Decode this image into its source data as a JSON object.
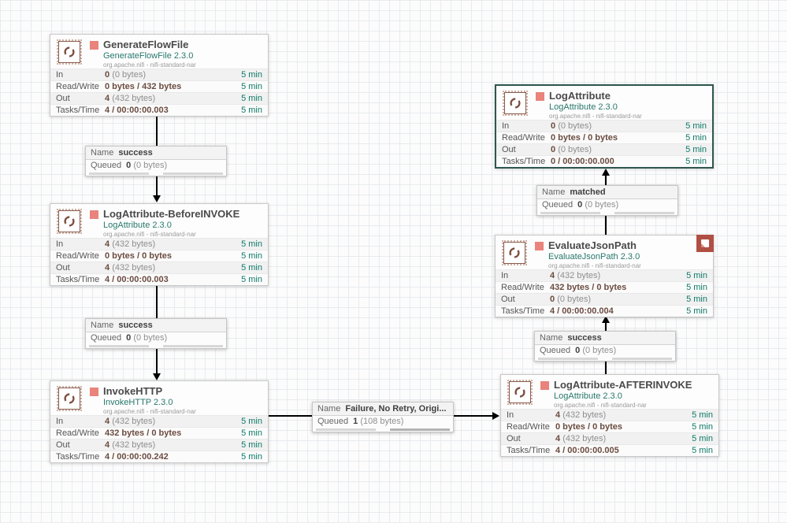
{
  "colors": {
    "run_stopped_square": "#e9837b",
    "type_teal": "#27786c",
    "period_teal": "#0f7a69",
    "bulletin_red": "#b04f44",
    "selection_border": "#2e564e",
    "connection_line": "#000000"
  },
  "processors": [
    {
      "name": "GenerateFlowFile",
      "type": "GenerateFlowFile 2.3.0",
      "bundle": "org.apache.nifi - nifi-standard-nar",
      "stats": [
        {
          "label": "In",
          "value": "0",
          "extra": "(0 bytes)",
          "period": "5 min"
        },
        {
          "label": "Read/Write",
          "value": "0 bytes / 432 bytes",
          "extra": "",
          "period": "5 min"
        },
        {
          "label": "Out",
          "value": "4",
          "extra": "(432 bytes)",
          "period": "5 min"
        },
        {
          "label": "Tasks/Time",
          "value": "4 / 00:00:00.003",
          "extra": "",
          "period": "5 min"
        }
      ]
    },
    {
      "name": "LogAttribute-BeforeINVOKE",
      "type": "LogAttribute 2.3.0",
      "bundle": "org.apache.nifi - nifi-standard-nar",
      "stats": [
        {
          "label": "In",
          "value": "4",
          "extra": "(432 bytes)",
          "period": "5 min"
        },
        {
          "label": "Read/Write",
          "value": "0 bytes / 0 bytes",
          "extra": "",
          "period": "5 min"
        },
        {
          "label": "Out",
          "value": "4",
          "extra": "(432 bytes)",
          "period": "5 min"
        },
        {
          "label": "Tasks/Time",
          "value": "4 / 00:00:00.003",
          "extra": "",
          "period": "5 min"
        }
      ]
    },
    {
      "name": "InvokeHTTP",
      "type": "InvokeHTTP 2.3.0",
      "bundle": "org.apache.nifi - nifi-standard-nar",
      "stats": [
        {
          "label": "In",
          "value": "4",
          "extra": "(432 bytes)",
          "period": "5 min"
        },
        {
          "label": "Read/Write",
          "value": "432 bytes / 0 bytes",
          "extra": "",
          "period": "5 min"
        },
        {
          "label": "Out",
          "value": "4",
          "extra": "(432 bytes)",
          "period": "5 min"
        },
        {
          "label": "Tasks/Time",
          "value": "4 / 00:00:00.242",
          "extra": "",
          "period": "5 min"
        }
      ]
    },
    {
      "name": "LogAttribute",
      "type": "LogAttribute 2.3.0",
      "bundle": "org.apache.nifi - nifi-standard-nar",
      "stats": [
        {
          "label": "In",
          "value": "0",
          "extra": "(0 bytes)",
          "period": "5 min"
        },
        {
          "label": "Read/Write",
          "value": "0 bytes / 0 bytes",
          "extra": "",
          "period": "5 min"
        },
        {
          "label": "Out",
          "value": "0",
          "extra": "(0 bytes)",
          "period": "5 min"
        },
        {
          "label": "Tasks/Time",
          "value": "0 / 00:00:00.000",
          "extra": "",
          "period": "5 min"
        }
      ]
    },
    {
      "name": "EvaluateJsonPath",
      "type": "EvaluateJsonPath 2.3.0",
      "bundle": "org.apache.nifi - nifi-standard-nar",
      "stats": [
        {
          "label": "In",
          "value": "4",
          "extra": "(432 bytes)",
          "period": "5 min"
        },
        {
          "label": "Read/Write",
          "value": "432 bytes / 0 bytes",
          "extra": "",
          "period": "5 min"
        },
        {
          "label": "Out",
          "value": "0",
          "extra": "(0 bytes)",
          "period": "5 min"
        },
        {
          "label": "Tasks/Time",
          "value": "4 / 00:00:00.004",
          "extra": "",
          "period": "5 min"
        }
      ]
    },
    {
      "name": "LogAttribute-AFTERINVOKE",
      "type": "LogAttribute 2.3.0",
      "bundle": "org.apache.nifi - nifi-standard-nar",
      "stats": [
        {
          "label": "In",
          "value": "4",
          "extra": "(432 bytes)",
          "period": "5 min"
        },
        {
          "label": "Read/Write",
          "value": "0 bytes / 0 bytes",
          "extra": "",
          "period": "5 min"
        },
        {
          "label": "Out",
          "value": "4",
          "extra": "(432 bytes)",
          "period": "5 min"
        },
        {
          "label": "Tasks/Time",
          "value": "4 / 00:00:00.005",
          "extra": "",
          "period": "5 min"
        }
      ]
    }
  ],
  "connections": [
    {
      "key_name": "Name",
      "name": "success",
      "key_queued": "Queued",
      "queued": "0",
      "extra": "(0 bytes)"
    },
    {
      "key_name": "Name",
      "name": "success",
      "key_queued": "Queued",
      "queued": "0",
      "extra": "(0 bytes)"
    },
    {
      "key_name": "Name",
      "name": "Failure, No Retry, Origi...",
      "key_queued": "Queued",
      "queued": "1",
      "extra": "(108 bytes)"
    },
    {
      "key_name": "Name",
      "name": "success",
      "key_queued": "Queued",
      "queued": "0",
      "extra": "(0 bytes)"
    },
    {
      "key_name": "Name",
      "name": "matched",
      "key_queued": "Queued",
      "queued": "0",
      "extra": "(0 bytes)"
    }
  ]
}
